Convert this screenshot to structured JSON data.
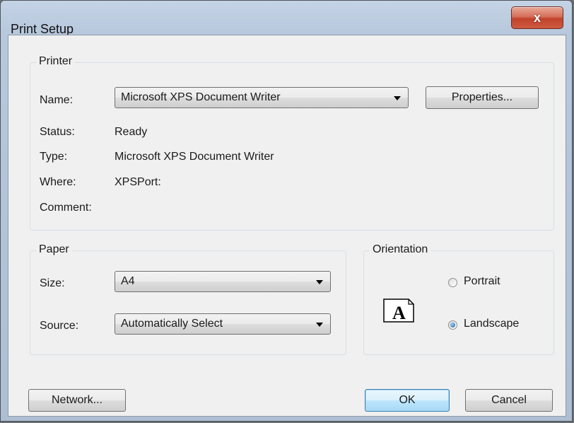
{
  "window": {
    "title": "Print Setup",
    "close_glyph": "x"
  },
  "printer": {
    "group_label": "Printer",
    "name_label": "Name:",
    "name_value": "Microsoft XPS Document Writer",
    "properties_button": "Properties...",
    "status_label": "Status:",
    "status_value": "Ready",
    "type_label": "Type:",
    "type_value": "Microsoft XPS Document Writer",
    "where_label": "Where:",
    "where_value": "XPSPort:",
    "comment_label": "Comment:"
  },
  "paper": {
    "group_label": "Paper",
    "size_label": "Size:",
    "size_value": "A4",
    "source_label": "Source:",
    "source_value": "Automatically Select"
  },
  "orientation": {
    "group_label": "Orientation",
    "icon_letter": "A",
    "portrait_label": "Portrait",
    "landscape_label": "Landscape",
    "selected": "Landscape"
  },
  "buttons": {
    "network": "Network...",
    "ok": "OK",
    "cancel": "Cancel"
  },
  "colors": {
    "title_bar": "#b7c8dd",
    "close_button": "#c1432b",
    "dialog_bg": "#f0f0f0",
    "default_button": "#3c7fb1"
  }
}
